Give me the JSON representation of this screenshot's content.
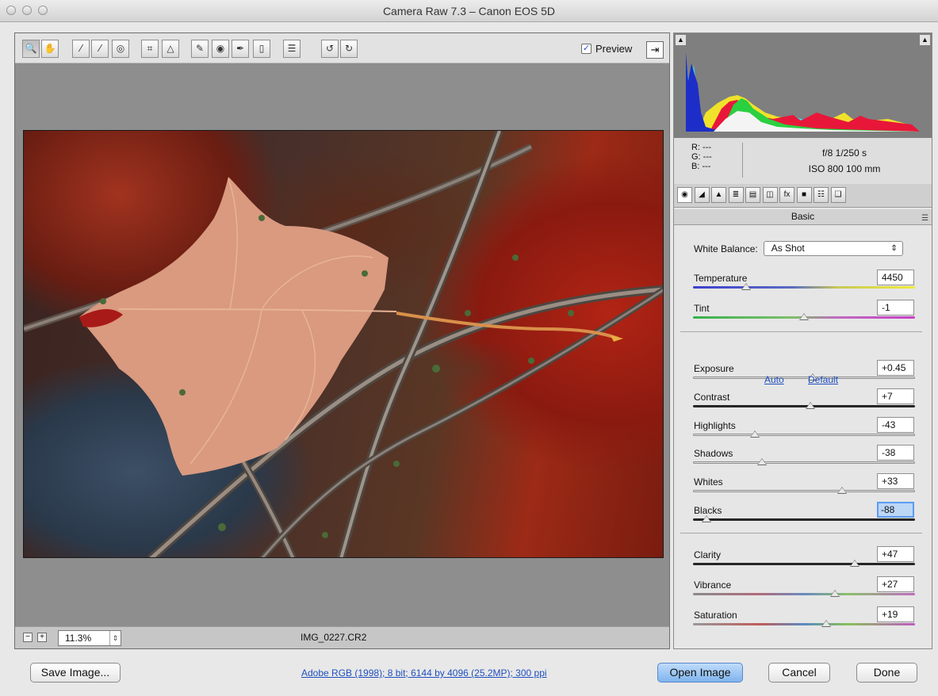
{
  "window": {
    "title": "Camera Raw 7.3  –  Canon EOS 5D"
  },
  "toolbar": {
    "tools": [
      {
        "name": "zoom-tool-icon",
        "glyph": "🔍"
      },
      {
        "name": "hand-tool-icon",
        "glyph": "✋"
      },
      {
        "name": "white-balance-tool-icon",
        "glyph": "⁄"
      },
      {
        "name": "color-sampler-tool-icon",
        "glyph": "⁄"
      },
      {
        "name": "targeted-adjustment-tool-icon",
        "glyph": "◎"
      },
      {
        "name": "crop-tool-icon",
        "glyph": "⌗"
      },
      {
        "name": "straighten-tool-icon",
        "glyph": "△"
      },
      {
        "name": "spot-removal-tool-icon",
        "glyph": "✎"
      },
      {
        "name": "red-eye-removal-tool-icon",
        "glyph": "◉"
      },
      {
        "name": "adjustment-brush-icon",
        "glyph": "✒"
      },
      {
        "name": "graduated-filter-icon",
        "glyph": "▯"
      },
      {
        "name": "preferences-icon",
        "glyph": "☰"
      },
      {
        "name": "rotate-ccw-icon",
        "glyph": "↺"
      },
      {
        "name": "rotate-cw-icon",
        "glyph": "↻"
      }
    ],
    "preview_label": "Preview",
    "preview_checked": true
  },
  "status": {
    "zoom": "11.3%",
    "filename": "IMG_0227.CR2"
  },
  "info": {
    "r": "R:  ---",
    "g": "G:  ---",
    "b": "B:  ---",
    "exposure": "f/8   1/250 s",
    "iso": "ISO 800   100 mm"
  },
  "tabs": [
    "basic-tab-icon",
    "tone-curve-tab-icon",
    "detail-tab-icon",
    "hsl-tab-icon",
    "split-toning-tab-icon",
    "lens-corrections-tab-icon",
    "effects-tab-icon",
    "camera-calibration-tab-icon",
    "presets-tab-icon",
    "snapshots-tab-icon"
  ],
  "panel": {
    "title": "Basic",
    "white_balance_label": "White Balance:",
    "white_balance_value": "As Shot",
    "auto_label": "Auto",
    "default_label": "Default",
    "temperature": {
      "label": "Temperature",
      "value": "4450",
      "pos": 0.24
    },
    "tint": {
      "label": "Tint",
      "value": "-1",
      "pos": 0.5
    },
    "exposure": {
      "label": "Exposure",
      "value": "+0.45",
      "pos": 0.54
    },
    "contrast": {
      "label": "Contrast",
      "value": "+7",
      "pos": 0.53
    },
    "highlights": {
      "label": "Highlights",
      "value": "-43",
      "pos": 0.28
    },
    "shadows": {
      "label": "Shadows",
      "value": "-38",
      "pos": 0.31
    },
    "whites": {
      "label": "Whites",
      "value": "+33",
      "pos": 0.67
    },
    "blacks": {
      "label": "Blacks",
      "value": "-88",
      "pos": 0.06
    },
    "clarity": {
      "label": "Clarity",
      "value": "+47",
      "pos": 0.73
    },
    "vibrance": {
      "label": "Vibrance",
      "value": "+27",
      "pos": 0.64
    },
    "saturation": {
      "label": "Saturation",
      "value": "+19",
      "pos": 0.6
    }
  },
  "footer": {
    "save": "Save Image...",
    "color_info": "Adobe RGB (1998); 8 bit; 6144 by 4096 (25.2MP); 300 ppi",
    "open": "Open Image",
    "cancel": "Cancel",
    "done": "Done"
  }
}
